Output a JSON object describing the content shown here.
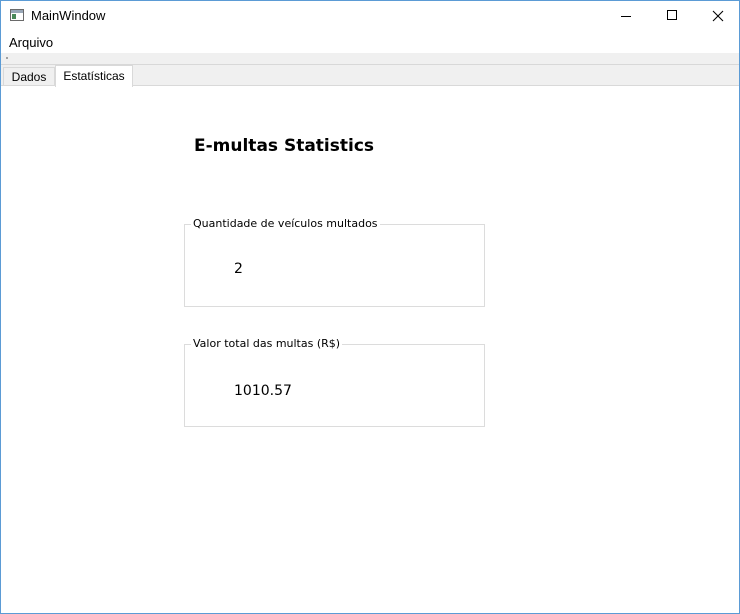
{
  "window": {
    "title": "MainWindow",
    "controls": {
      "minimize_icon": "minimize-icon",
      "maximize_icon": "maximize-icon",
      "close_icon": "close-icon"
    }
  },
  "menubar": {
    "items": [
      {
        "label": "Arquivo"
      }
    ]
  },
  "tabs": [
    {
      "label": "Dados",
      "active": false
    },
    {
      "label": "Estatísticas",
      "active": true
    }
  ],
  "stats": {
    "title": "E-multas Statistics",
    "vehicles": {
      "label": "Quantidade de veículos multados",
      "value": "2"
    },
    "total": {
      "label": "Valor total das multas (R$)",
      "value": "1010.57"
    }
  },
  "colors": {
    "window_border": "#5b9bd5",
    "background": "#f0f0f0",
    "panel": "#ffffff",
    "groupbox_border": "#dcdcdc"
  }
}
